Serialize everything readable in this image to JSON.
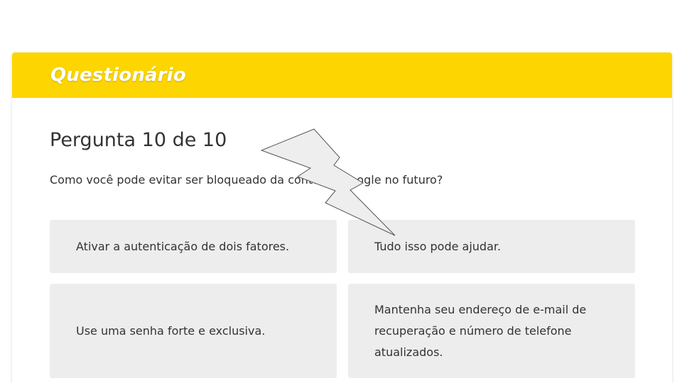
{
  "quiz": {
    "title": "Questionário",
    "question_number": "Pergunta 10 de 10",
    "question_text": "Como você pode evitar ser bloqueado da conta do Google no futuro?",
    "options": [
      {
        "label": "Ativar a autenticação de dois fatores."
      },
      {
        "label": "Tudo isso pode ajudar."
      },
      {
        "label": "Use uma senha forte e exclusiva."
      },
      {
        "label": "Mantenha seu endereço de e-mail de recuperação e número de telefone atualizados."
      }
    ]
  },
  "colors": {
    "header_bg": "#fdd500",
    "option_bg": "#ededed",
    "text": "#333333"
  },
  "icons": {
    "pointer": "lightning-pointer-icon"
  }
}
